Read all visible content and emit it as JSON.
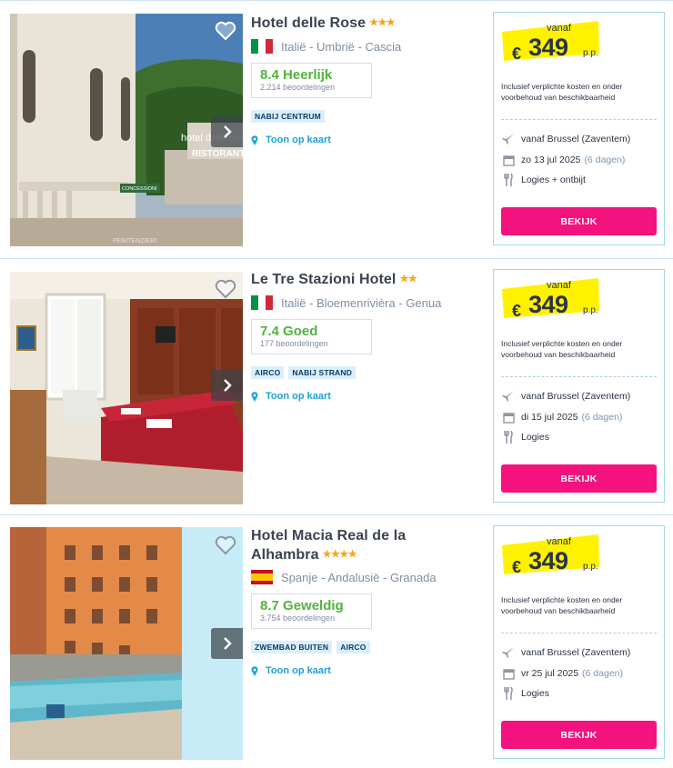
{
  "colors": {
    "accent_button": "#f3127e",
    "score_green": "#51b33f",
    "link_blue": "#1fa0da",
    "price_highlight": "#fff200",
    "star": "#f5a51d"
  },
  "hotels": [
    {
      "name": "Hotel delle Rose",
      "stars": "★★★",
      "location": "Italië - Umbrië - Cascia",
      "flag": "italy",
      "score": "8.4",
      "score_label": "Heerlijk",
      "reviews": "2.214 beoordelingen",
      "tags": [
        "NABIJ CENTRUM"
      ],
      "map_link": "Toon op kaart",
      "price": {
        "vanaf": "vanaf",
        "currency": "€",
        "amount": "349",
        "pp": "p.p."
      },
      "disclaimer": "Inclusief verplichte kosten en onder voorbehoud van beschikbaarheid",
      "departure": "vanaf Brussel (Zaventem)",
      "date": "zo 13 jul 2025",
      "duration": "(6 dagen)",
      "board": "Logies + ontbijt",
      "button": "BEKIJK"
    },
    {
      "name": "Le Tre Stazioni Hotel",
      "stars": "★★",
      "location": "Italië - Bloemenrivièra - Genua",
      "flag": "italy",
      "score": "7.4",
      "score_label": "Goed",
      "reviews": "177 beoordelingen",
      "tags": [
        "AIRCO",
        "NABIJ STRAND"
      ],
      "map_link": "Toon op kaart",
      "price": {
        "vanaf": "vanaf",
        "currency": "€",
        "amount": "349",
        "pp": "p.p."
      },
      "disclaimer": "Inclusief verplichte kosten en onder voorbehoud van beschikbaarheid",
      "departure": "vanaf Brussel (Zaventem)",
      "date": "di 15 jul 2025",
      "duration": "(6 dagen)",
      "board": "Logies",
      "button": "BEKIJK"
    },
    {
      "name_line1": "Hotel Macia Real de la",
      "name_line2": "Alhambra",
      "stars": "★★★★",
      "location": "Spanje - Andalusië - Granada",
      "flag": "spain",
      "score": "8.7",
      "score_label": "Geweldig",
      "reviews": "3.754 beoordelingen",
      "tags": [
        "ZWEMBAD BUITEN",
        "AIRCO"
      ],
      "map_link": "Toon op kaart",
      "price": {
        "vanaf": "vanaf",
        "currency": "€",
        "amount": "349",
        "pp": "p.p."
      },
      "disclaimer": "Inclusief verplichte kosten en onder voorbehoud van beschikbaarheid",
      "departure": "vanaf Brussel (Zaventem)",
      "date": "vr 25 jul 2025",
      "duration": "(6 dagen)",
      "board": "Logies",
      "button": "BEKIJK"
    }
  ],
  "photo_text": {
    "hotel0_sign_1": "hotel delle rose",
    "hotel0_sign_2": "RISTORANTE",
    "hotel0_street_sign": "CONCESSIONI",
    "hotel0_watermark": "PENITENZIERI"
  }
}
